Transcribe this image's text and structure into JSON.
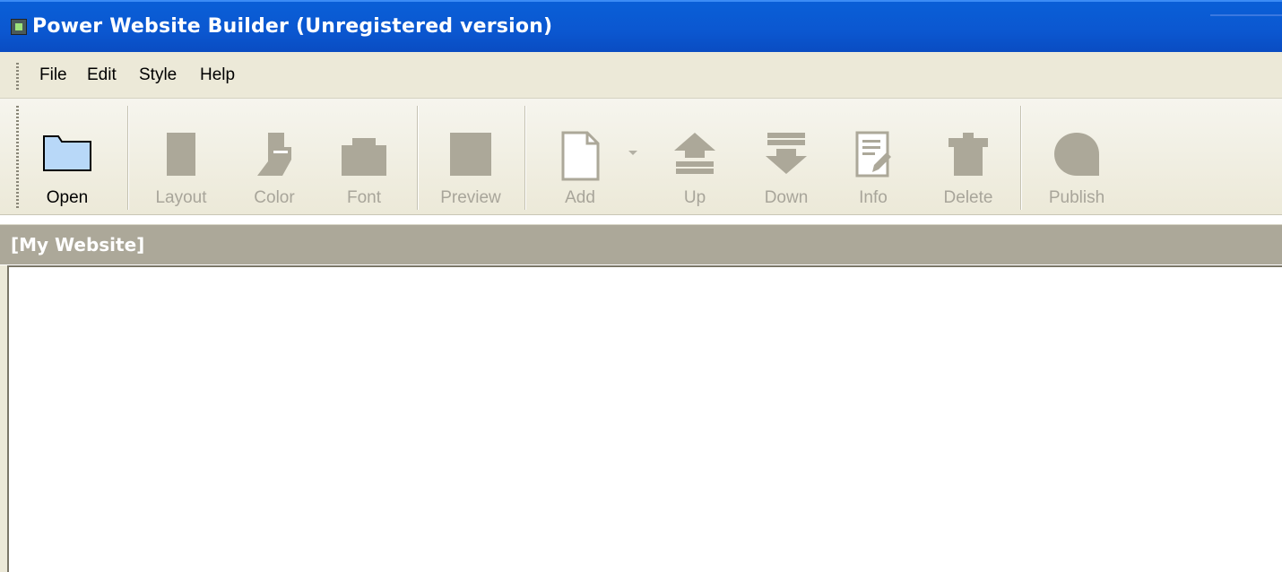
{
  "window": {
    "title": "Power Website Builder (Unregistered version)",
    "icon": "app-icon"
  },
  "menu": [
    "File",
    "Edit",
    "Style",
    "Help"
  ],
  "toolbar": {
    "buttons": [
      {
        "label": "Open",
        "icon": "folder-icon",
        "enabled": true
      },
      {
        "label": "Layout",
        "icon": "layout-icon",
        "enabled": false
      },
      {
        "label": "Color",
        "icon": "color-icon",
        "enabled": false
      },
      {
        "label": "Font",
        "icon": "font-icon",
        "enabled": false
      },
      {
        "label": "Preview",
        "icon": "preview-icon",
        "enabled": false
      },
      {
        "label": "Add",
        "icon": "page-icon",
        "enabled": false
      },
      {
        "label": "Up",
        "icon": "up-arrow-icon",
        "enabled": false
      },
      {
        "label": "Down",
        "icon": "down-arrow-icon",
        "enabled": false
      },
      {
        "label": "Info",
        "icon": "info-document-icon",
        "enabled": false
      },
      {
        "label": "Delete",
        "icon": "trash-icon",
        "enabled": false
      },
      {
        "label": "Publish",
        "icon": "globe-icon",
        "enabled": false
      }
    ]
  },
  "panel": {
    "header": "[My Website]"
  },
  "colors": {
    "titlebar": "#0b57d0",
    "menubar": "#ece9d8",
    "panel_header": "#aca899",
    "disabled_icon": "#aca899"
  }
}
